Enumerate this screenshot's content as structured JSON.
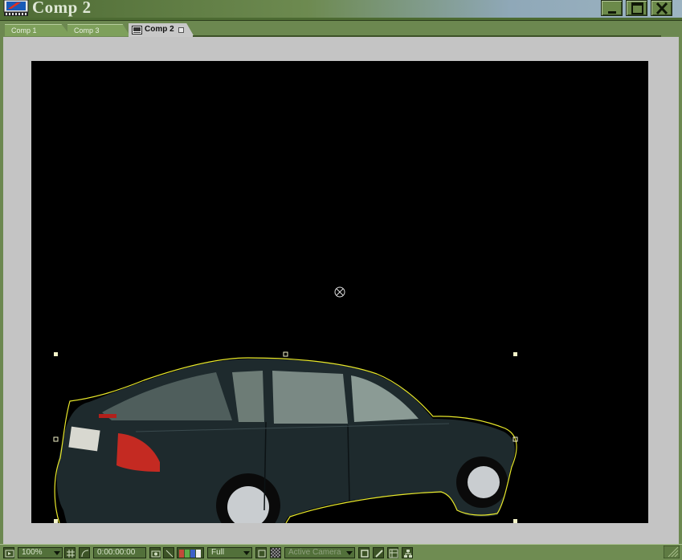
{
  "window": {
    "title": "Comp 2",
    "colors": {
      "frame": "#6c8850",
      "titlebar": "#4e6b34",
      "viewer_bg": "#c4c4c4",
      "canvas": "#000000",
      "mask": "#e8e82a"
    }
  },
  "tabs": [
    {
      "label": "Comp 1",
      "active": false
    },
    {
      "label": "Comp 3",
      "active": false
    },
    {
      "label": "Comp 2",
      "active": true
    }
  ],
  "toolbar": {
    "magnification": "100%",
    "timecode": "0:00:00:00",
    "resolution": "Full",
    "camera": "Active Camera",
    "icons": [
      "always-preview-icon",
      "grid-icon",
      "mask-toggle-icon",
      "snapshot-icon",
      "show-snapshot-icon",
      "channel-rgb-icon",
      "region-of-interest-icon",
      "transparency-grid-icon",
      "fast-preview-icon",
      "flowchart-icon",
      "comp-flowchart-icon"
    ]
  }
}
